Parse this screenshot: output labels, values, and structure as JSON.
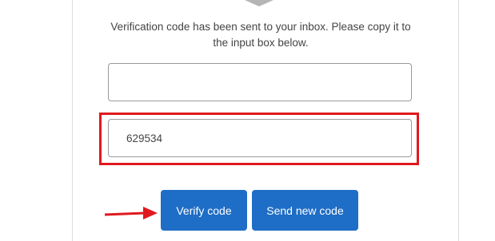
{
  "message": "Verification code has been sent to your inbox. Please copy it to the input box below.",
  "email_field": {
    "value": ""
  },
  "code_field": {
    "value": "629534"
  },
  "buttons": {
    "verify_label": "Verify code",
    "send_new_label": "Send new code"
  },
  "colors": {
    "button": "#1e6dc6",
    "highlight": "#e0191f",
    "text": "#444444"
  },
  "icons": {
    "annotation_arrow": "right-arrow-icon",
    "logo": "logo-icon"
  }
}
